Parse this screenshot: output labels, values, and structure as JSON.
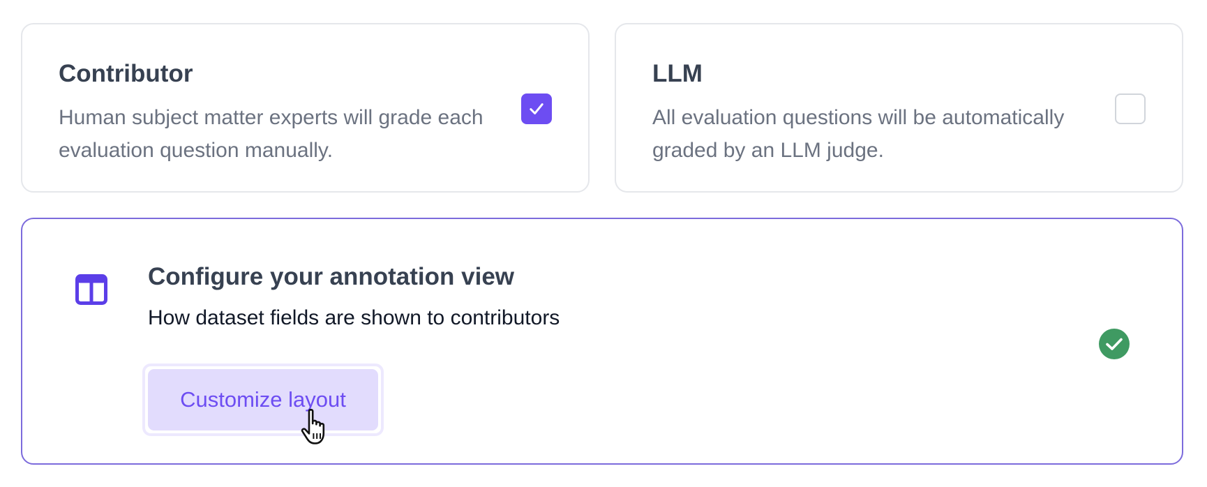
{
  "evaluation_methods": [
    {
      "title": "Contributor",
      "description": "Human subject matter experts will grade each evaluation question manually.",
      "selected": true
    },
    {
      "title": "LLM",
      "description": "All evaluation questions will be automatically graded by an LLM judge.",
      "selected": false
    }
  ],
  "annotation_view": {
    "icon": "layout-columns-icon",
    "title": "Configure your annotation view",
    "description": "How dataset fields are shown to contributors",
    "button_label": "Customize layout",
    "status_icon": "check-circle-icon",
    "status": "complete"
  },
  "colors": {
    "accent": "#6d4df2",
    "accent_light": "#e2dcfd",
    "success": "#3f9a62",
    "text_heading": "#374151",
    "text_muted": "#6b7280",
    "border": "#e5e7eb",
    "active_border": "#7c6bdc"
  }
}
